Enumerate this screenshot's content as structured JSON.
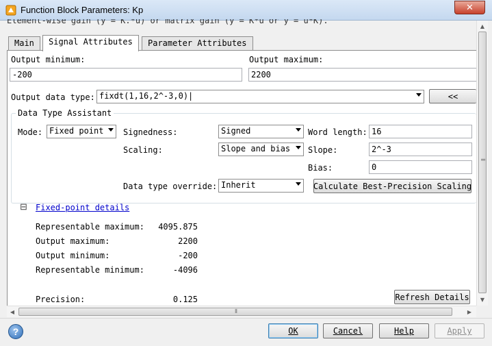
{
  "window": {
    "title": "Function Block Parameters: Kp",
    "close_glyph": "✕"
  },
  "description_fragment": "Element-wise gain (y = K.*u) or matrix gain (y = K*u or y = u*K).",
  "tabs": [
    {
      "label": "Main",
      "active": false
    },
    {
      "label": "Signal Attributes",
      "active": true
    },
    {
      "label": "Parameter Attributes",
      "active": false
    }
  ],
  "signal": {
    "output_min_label": "Output minimum:",
    "output_min_value": "-200",
    "output_max_label": "Output maximum:",
    "output_max_value": "2200",
    "data_type_label": "Output data type:",
    "data_type_value": "fixdt(1,16,2^-3,0)|",
    "assistant_button": "<<"
  },
  "assistant": {
    "legend": "Data Type Assistant",
    "mode_label": "Mode:",
    "mode_value": "Fixed point",
    "signedness_label": "Signedness:",
    "signedness_value": "Signed",
    "word_length_label": "Word length:",
    "word_length_value": "16",
    "scaling_label": "Scaling:",
    "scaling_value": "Slope and bias",
    "slope_label": "Slope:",
    "slope_value": "2^-3",
    "bias_label": "Bias:",
    "bias_value": "0",
    "override_label": "Data type override:",
    "override_value": "Inherit",
    "calc_button": "Calculate Best-Precision Scaling"
  },
  "details": {
    "toggle": "⊟",
    "link": "Fixed-point details",
    "rows": [
      {
        "label": "Representable maximum:",
        "value": "4095.875"
      },
      {
        "label": "Output maximum:",
        "value": "2200"
      },
      {
        "label": "Output minimum:",
        "value": "-200"
      },
      {
        "label": "Representable minimum:",
        "value": "-4096"
      },
      {
        "label": "Precision:",
        "value": "0.125"
      }
    ],
    "refresh_button": "Refresh Details"
  },
  "scroll": {
    "up": "▲",
    "down": "▼",
    "left": "◀",
    "right": "▶",
    "grip": "⦀"
  },
  "footer": {
    "help_icon": "?",
    "ok_label": "OK",
    "cancel_label": "Cancel",
    "help_label": "Help",
    "apply_label": "Apply"
  },
  "colors": {
    "link": "#0000cc",
    "title_bar": "#c4d8ef",
    "close_button": "#c8412c"
  }
}
